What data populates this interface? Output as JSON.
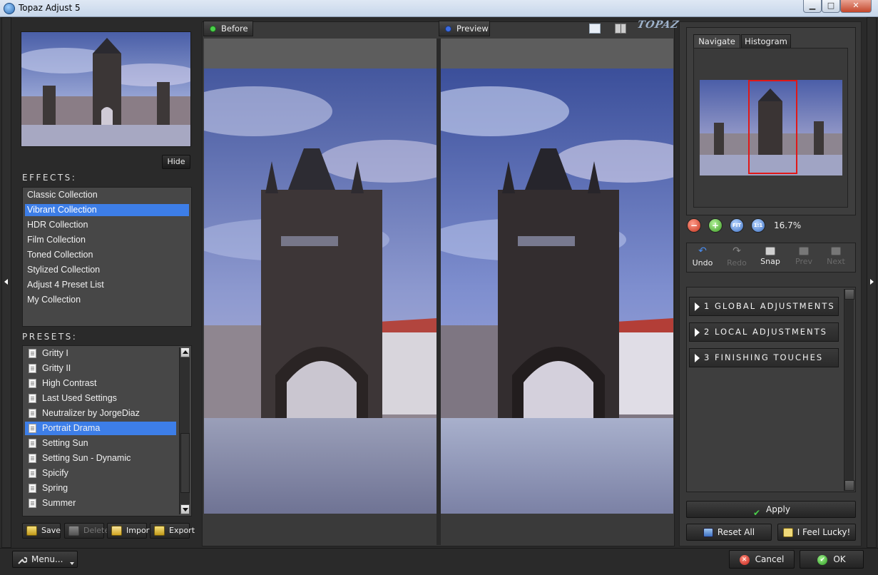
{
  "window": {
    "title": "Topaz Adjust 5",
    "controls": {
      "minimize": "▁",
      "maximize": "□",
      "close": "✕"
    }
  },
  "left": {
    "hide_label": "Hide",
    "effects_label": "EFFECTS:",
    "effects": [
      {
        "label": "Classic Collection",
        "selected": false
      },
      {
        "label": "Vibrant Collection",
        "selected": true
      },
      {
        "label": "HDR Collection",
        "selected": false
      },
      {
        "label": "Film Collection",
        "selected": false
      },
      {
        "label": "Toned Collection",
        "selected": false
      },
      {
        "label": "Stylized Collection",
        "selected": false
      },
      {
        "label": "Adjust 4 Preset List",
        "selected": false
      },
      {
        "label": "My Collection",
        "selected": false
      }
    ],
    "presets_label": "PRESETS:",
    "presets": [
      {
        "label": "Gritty I",
        "selected": false
      },
      {
        "label": "Gritty II",
        "selected": false
      },
      {
        "label": "High Contrast",
        "selected": false
      },
      {
        "label": "Last Used Settings",
        "selected": false
      },
      {
        "label": "Neutralizer by JorgeDiaz",
        "selected": false
      },
      {
        "label": "Portrait Drama",
        "selected": true
      },
      {
        "label": "Setting Sun",
        "selected": false
      },
      {
        "label": "Setting Sun - Dynamic",
        "selected": false
      },
      {
        "label": "Spicify",
        "selected": false
      },
      {
        "label": "Spring",
        "selected": false
      },
      {
        "label": "Summer",
        "selected": false
      }
    ],
    "buttons": {
      "save": "Save",
      "delete": "Delete",
      "import": "Import",
      "export": "Export"
    }
  },
  "center": {
    "before_tab": "Before",
    "preview_tab": "Preview",
    "logo_text": "TOPAZ"
  },
  "right": {
    "tabs": {
      "navigate": "Navigate",
      "histogram": "Histogram"
    },
    "zoom": {
      "minus": "−",
      "plus": "+",
      "fit": "FIT",
      "one": "1:1",
      "level": "16.7%"
    },
    "history": {
      "undo": "Undo",
      "redo": "Redo",
      "snap": "Snap",
      "prev": "Prev",
      "next": "Next"
    },
    "adjustments": [
      "1 GLOBAL ADJUSTMENTS",
      "2 LOCAL ADJUSTMENTS",
      "3 FINISHING TOUCHES"
    ],
    "apply": "Apply",
    "reset_all": "Reset All",
    "feel_lucky": "I Feel Lucky!"
  },
  "footer": {
    "menu": "Menu...",
    "cancel": "Cancel",
    "ok": "OK"
  },
  "colors": {
    "selection": "#3d7ee8",
    "nav_rect": "#e01818"
  }
}
